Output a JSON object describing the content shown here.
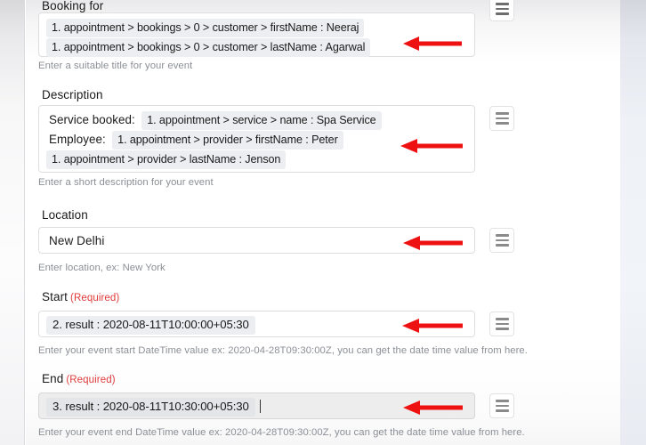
{
  "app": {
    "accent_red": "#ee1111",
    "chip_bg": "#eceef1",
    "required_color": "#e03a3a",
    "helper_color": "#8b8f95"
  },
  "form": {
    "fields": [
      {
        "id": "booking-for",
        "label": "Booking for",
        "required": false,
        "helper": "Enter a suitable title for your event",
        "lines": [
          {
            "prefix": "",
            "chips": [
              "1. appointment > bookings > 0 > customer > firstName : Neeraj"
            ]
          },
          {
            "prefix": "",
            "chips": [
              "1. appointment > bookings > 0 > customer > lastName : Agarwal"
            ]
          }
        ],
        "handle_icon": "hamburger-icon",
        "has_arrow": true
      },
      {
        "id": "description",
        "label": "Description",
        "required": false,
        "helper": "Enter a short description for your event",
        "lines": [
          {
            "prefix": "Service booked:",
            "chips": [
              "1. appointment > service > name : Spa Service"
            ]
          },
          {
            "prefix": "Employee:",
            "chips": [
              "1. appointment > provider > firstName : Peter"
            ]
          },
          {
            "prefix": "",
            "chips": [
              "1. appointment > provider > lastName : Jenson"
            ]
          }
        ],
        "handle_icon": "hamburger-icon",
        "has_arrow": true
      },
      {
        "id": "location",
        "label": "Location",
        "required": false,
        "helper": "Enter location, ex: New York",
        "value": "New Delhi",
        "handle_icon": "hamburger-icon",
        "has_arrow": true
      },
      {
        "id": "start",
        "label": "Start",
        "required": true,
        "required_text": "(Required)",
        "helper": "Enter your event start DateTime value ex: 2020-04-28T09:30:00Z, you can get the date time value from here.",
        "lines": [
          {
            "prefix": "",
            "chips": [
              "2. result : 2020-08-11T10:00:00+05:30"
            ]
          }
        ],
        "handle_icon": "hamburger-icon",
        "has_arrow": true
      },
      {
        "id": "end",
        "label": "End",
        "required": true,
        "required_text": "(Required)",
        "helper": "Enter your event end DateTime value ex: 2020-04-28T09:30:00Z, you can get the date time value from here.",
        "focused": true,
        "lines": [
          {
            "prefix": "",
            "chips": [
              "3. result : 2020-08-11T10:30:00+05:30"
            ]
          }
        ],
        "handle_icon": "hamburger-icon",
        "has_arrow": true
      }
    ]
  }
}
